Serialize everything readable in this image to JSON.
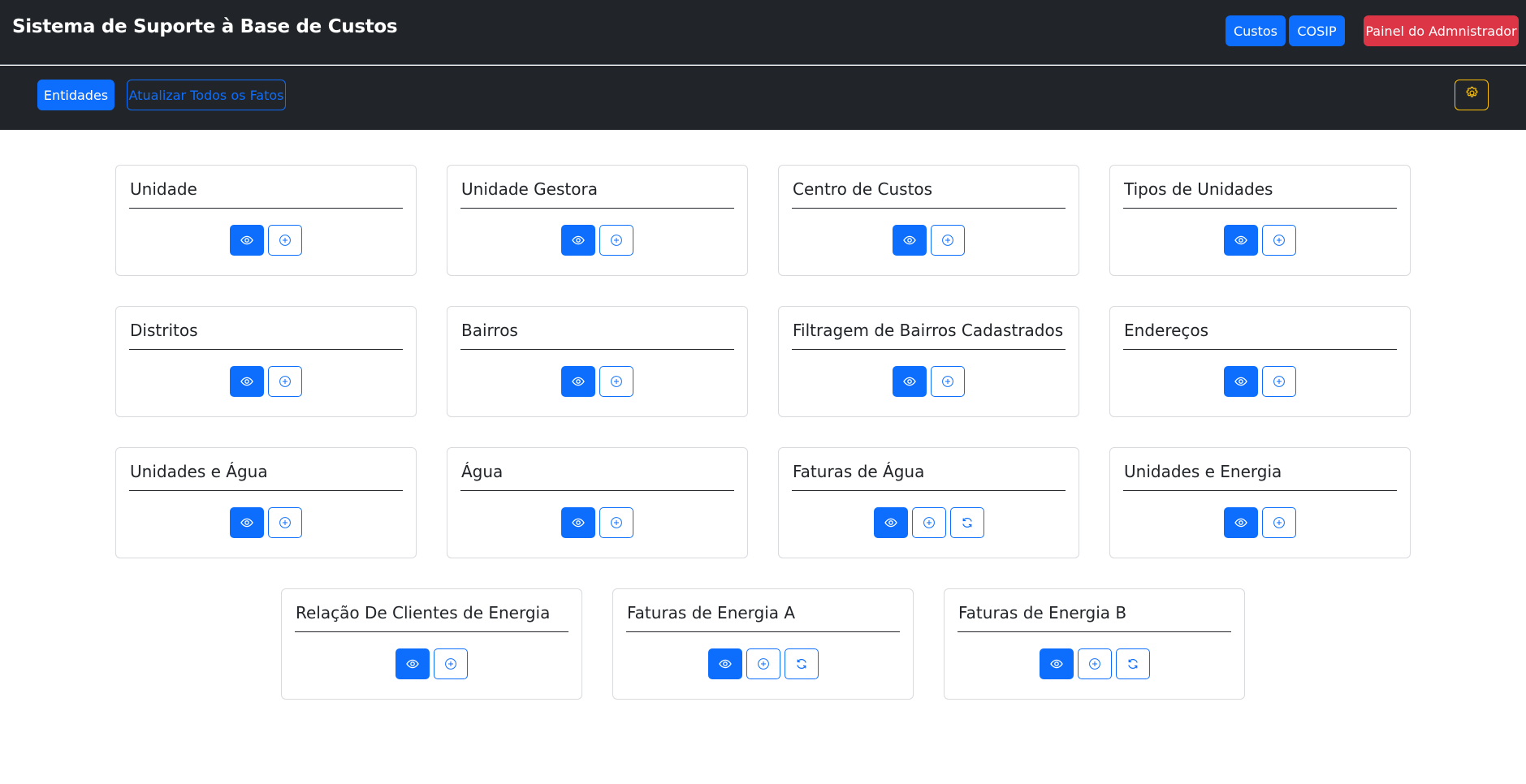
{
  "header": {
    "title": "Sistema de Suporte à Base de Custos",
    "buttons": {
      "custos": "Custos",
      "cosip": "COSIP",
      "admin": "Painel do Admnistrador"
    }
  },
  "subnav": {
    "entidades": "Entidades",
    "atualizar": "Atualizar Todos os Fatos",
    "settings_icon": "gear-icon"
  },
  "colors": {
    "primary": "#0d6efd",
    "danger": "#dc3545",
    "warning": "#ffc107",
    "dark": "#212529"
  },
  "cards": [
    {
      "title": "Unidade",
      "actions": [
        "view-icon",
        "add-icon"
      ]
    },
    {
      "title": "Unidade Gestora",
      "actions": [
        "view-icon",
        "add-icon"
      ]
    },
    {
      "title": "Centro de Custos",
      "actions": [
        "view-icon",
        "add-icon"
      ]
    },
    {
      "title": "Tipos de Unidades",
      "actions": [
        "view-icon",
        "add-icon"
      ]
    },
    {
      "title": "Distritos",
      "actions": [
        "view-icon",
        "add-icon"
      ]
    },
    {
      "title": "Bairros",
      "actions": [
        "view-icon",
        "add-icon"
      ]
    },
    {
      "title": "Filtragem de Bairros Cadastrados",
      "actions": [
        "view-icon",
        "add-icon"
      ]
    },
    {
      "title": "Endereços",
      "actions": [
        "view-icon",
        "add-icon"
      ]
    },
    {
      "title": "Unidades e Água",
      "actions": [
        "view-icon",
        "add-icon"
      ]
    },
    {
      "title": "Água",
      "actions": [
        "view-icon",
        "add-icon"
      ]
    },
    {
      "title": "Faturas de Água",
      "actions": [
        "view-icon",
        "add-icon",
        "sync-icon"
      ]
    },
    {
      "title": "Unidades e Energia",
      "actions": [
        "view-icon",
        "add-icon"
      ]
    },
    {
      "title": "Relação De Clientes de Energia",
      "actions": [
        "view-icon",
        "add-icon"
      ]
    },
    {
      "title": "Faturas de Energia A",
      "actions": [
        "view-icon",
        "add-icon",
        "sync-icon"
      ]
    },
    {
      "title": "Faturas de Energia B",
      "actions": [
        "view-icon",
        "add-icon",
        "sync-icon"
      ]
    }
  ]
}
